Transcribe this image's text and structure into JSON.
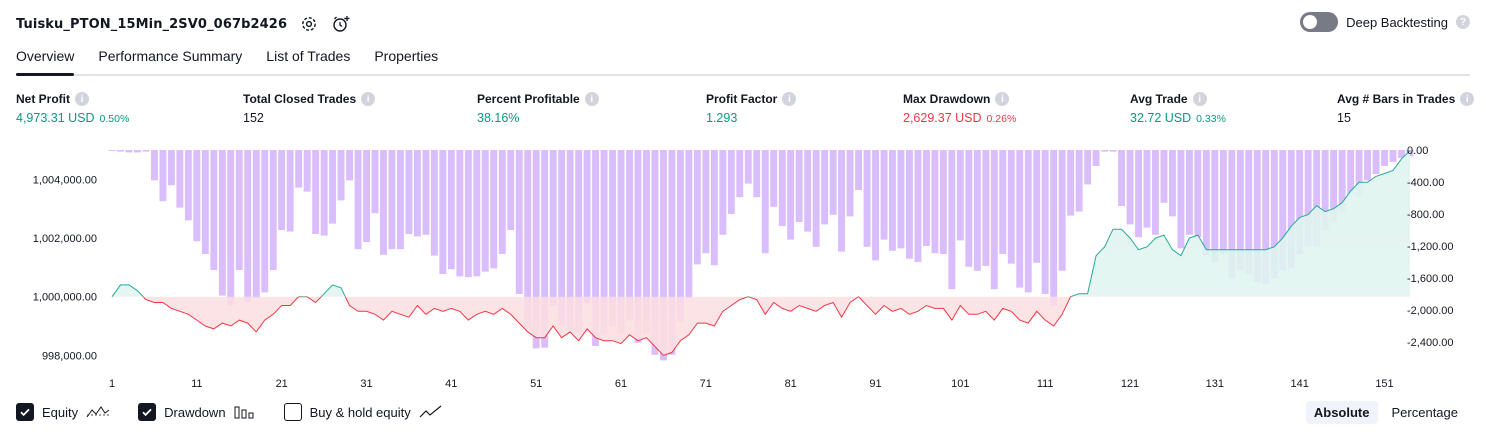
{
  "header": {
    "title": "Tuisku_PTON_15Min_2SV0_067b2426",
    "settings_icon": "gear-icon",
    "alert_icon": "alarm-clock-plus-icon"
  },
  "deep_backtesting": {
    "label": "Deep Backtesting",
    "enabled": false,
    "help_icon": "question-icon"
  },
  "tabs": [
    {
      "label": "Overview",
      "active": true
    },
    {
      "label": "Performance Summary",
      "active": false
    },
    {
      "label": "List of Trades",
      "active": false
    },
    {
      "label": "Properties",
      "active": false
    }
  ],
  "metrics": [
    {
      "label": "Net Profit",
      "value": "4,973.31 USD",
      "pct": "0.50%",
      "color": "#089981"
    },
    {
      "label": "Total Closed Trades",
      "value": "152",
      "pct": "",
      "color": "#131722"
    },
    {
      "label": "Percent Profitable",
      "value": "38.16%",
      "pct": "",
      "color": "#089981"
    },
    {
      "label": "Profit Factor",
      "value": "1.293",
      "pct": "",
      "color": "#089981"
    },
    {
      "label": "Max Drawdown",
      "value": "2,629.37 USD",
      "pct": "0.26%",
      "color": "#f23645"
    },
    {
      "label": "Avg Trade",
      "value": "32.72 USD",
      "pct": "0.33%",
      "color": "#089981"
    },
    {
      "label": "Avg # Bars in Trades",
      "value": "15",
      "pct": "",
      "color": "#131722"
    }
  ],
  "chart_data": {
    "type": "line",
    "title": "",
    "series": [
      {
        "name": "Equity",
        "axis": "left",
        "baseline": 1000000,
        "values": [
          1000000,
          1000400,
          1000400,
          1000200,
          999900,
          999800,
          999800,
          999600,
          999500,
          999400,
          999200,
          999000,
          998900,
          999100,
          999000,
          999200,
          999100,
          998800,
          999200,
          999400,
          999700,
          999700,
          1000000,
          1000000,
          999800,
          1000100,
          1000400,
          1000300,
          999700,
          999500,
          999500,
          999400,
          999200,
          999500,
          999400,
          999300,
          999700,
          999400,
          999600,
          999500,
          999600,
          999500,
          999200,
          999400,
          999500,
          999400,
          999600,
          999400,
          999100,
          998800,
          998600,
          998600,
          999000,
          998600,
          998800,
          998500,
          998900,
          998600,
          998500,
          998500,
          998400,
          998700,
          998500,
          998600,
          998300,
          998000,
          998100,
          998500,
          998700,
          999100,
          999100,
          999000,
          999500,
          999700,
          999900,
          1000000,
          999900,
          999400,
          999800,
          999600,
          999500,
          999700,
          999600,
          999500,
          999700,
          999800,
          999300,
          999800,
          1000000,
          999700,
          999400,
          999700,
          999500,
          999600,
          999400,
          999500,
          999700,
          999600,
          999600,
          999200,
          999700,
          999400,
          999400,
          999500,
          999200,
          999600,
          999500,
          999200,
          999100,
          999500,
          999200,
          999000,
          999400,
          1000000,
          1000100,
          1000100,
          1001400,
          1001700,
          1002300,
          1002300,
          1002000,
          1001600,
          1001700,
          1002000,
          1002100,
          1001600,
          1001400,
          1002000,
          1002100,
          1001600,
          1001600,
          1001600,
          1001600,
          1001600,
          1001600,
          1001600,
          1001600,
          1001700,
          1002000,
          1002400,
          1002700,
          1002800,
          1003100,
          1002900,
          1003000,
          1003200,
          1003600,
          1003900,
          1003900,
          1004100,
          1004200,
          1004300,
          1004700,
          1004973
        ]
      },
      {
        "name": "Drawdown",
        "axis": "right",
        "values": [
          0,
          -20,
          -30,
          -30,
          -20,
          -380,
          -640,
          -440,
          -720,
          -880,
          -1140,
          -1300,
          -1500,
          -1820,
          -1940,
          -1500,
          -1900,
          -1850,
          -1780,
          -1500,
          -1000,
          -1020,
          -470,
          -520,
          -1050,
          -1070,
          -920,
          -630,
          -380,
          -1240,
          -1150,
          -790,
          -1310,
          -1240,
          -1240,
          -1050,
          -1080,
          -1060,
          -1320,
          -1550,
          -1490,
          -1580,
          -1590,
          -1580,
          -1520,
          -1480,
          -1300,
          -1000,
          -1800,
          -2220,
          -2480,
          -2470,
          -1950,
          -2190,
          -2250,
          -2280,
          -1920,
          -2450,
          -2310,
          -2200,
          -2300,
          -2130,
          -2410,
          -2290,
          -2560,
          -2630,
          -2560,
          -2150,
          -1850,
          -1430,
          -1290,
          -1440,
          -1060,
          -800,
          -590,
          -420,
          -590,
          -1290,
          -710,
          -950,
          -1120,
          -900,
          -1020,
          -1210,
          -930,
          -810,
          -1270,
          -830,
          -500,
          -1210,
          -1380,
          -1120,
          -1260,
          -1230,
          -1360,
          -1400,
          -1200,
          -1290,
          -1300,
          -1740,
          -1130,
          -1460,
          -1510,
          -1450,
          -1740,
          -1300,
          -1420,
          -1720,
          -1780,
          -1410,
          -1800,
          -1950,
          -1510,
          -820,
          -770,
          -430,
          -200,
          -20,
          -20,
          -700,
          -930,
          -1090,
          -970,
          -1060,
          -660,
          -830,
          -1230,
          -1060,
          -1090,
          -1320,
          -1400,
          -1300,
          -1600,
          -1500,
          -1550,
          -1650,
          -1680,
          -1600,
          -1500,
          -1480,
          -1300,
          -1200,
          -1200,
          -1000,
          -900,
          -780,
          -550,
          -580,
          -380,
          -300,
          -200,
          -150,
          -100,
          -80
        ]
      }
    ],
    "left_axis": {
      "ticks": [
        "1,004,000.00",
        "1,002,000.00",
        "1,000,000.00",
        "998,000.00"
      ],
      "range": [
        997500,
        1005000
      ]
    },
    "right_axis": {
      "ticks": [
        "0.00",
        "-400.00",
        "-800.00",
        "-1,200.00",
        "-1,600.00",
        "-2,000.00",
        "-2,400.00"
      ],
      "range": [
        -2750,
        0
      ]
    },
    "x_ticks": [
      "1",
      "11",
      "21",
      "31",
      "41",
      "51",
      "61",
      "71",
      "81",
      "91",
      "101",
      "111",
      "121",
      "131",
      "141",
      "151"
    ],
    "x_range": [
      1,
      152
    ],
    "colors": {
      "equity_up": "#22ab94",
      "equity_down": "#f23645",
      "area_up": "#e0f4ef",
      "area_down": "#fcdfe1",
      "drawdown_bar": "#d4b2fb"
    }
  },
  "legend": {
    "items": [
      {
        "label": "Equity",
        "checked": true,
        "icon": "equity-line-icon"
      },
      {
        "label": "Drawdown",
        "checked": true,
        "icon": "bars-icon"
      },
      {
        "label": "Buy & hold equity",
        "checked": false,
        "icon": "trend-line-icon"
      }
    ]
  },
  "mode": {
    "options": [
      "Absolute",
      "Percentage"
    ],
    "selected": "Absolute"
  }
}
